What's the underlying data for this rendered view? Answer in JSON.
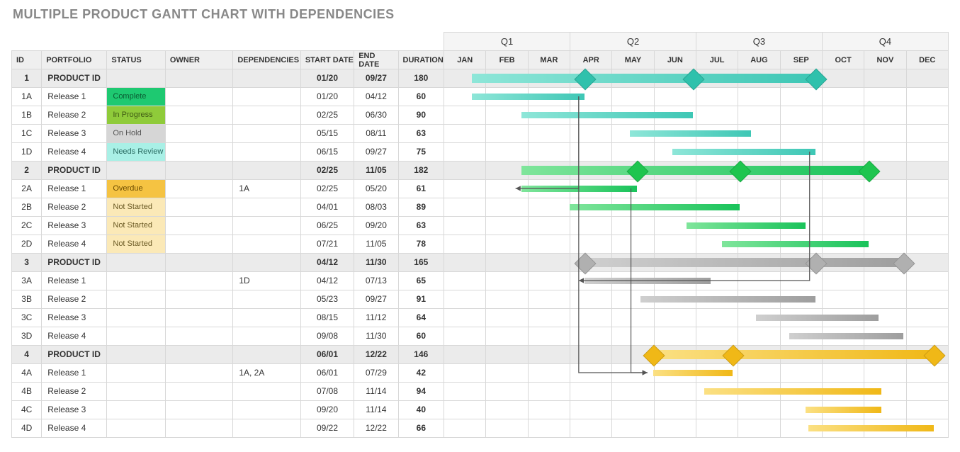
{
  "title": "MULTIPLE PRODUCT GANTT CHART WITH DEPENDENCIES",
  "columns": {
    "id": "ID",
    "portfolio": "PORTFOLIO",
    "status": "STATUS",
    "owner": "OWNER",
    "dependencies": "DEPENDENCIES",
    "start": "START DATE",
    "end": "END DATE",
    "duration": "DURATION"
  },
  "quarters": [
    "Q1",
    "Q2",
    "Q3",
    "Q4"
  ],
  "months": [
    "JAN",
    "FEB",
    "MAR",
    "APR",
    "MAY",
    "JUN",
    "JUL",
    "AUG",
    "SEP",
    "OCT",
    "NOV",
    "DEC"
  ],
  "status_labels": {
    "complete": "Complete",
    "progress": "In Progress",
    "hold": "On Hold",
    "review": "Needs Review",
    "overdue": "Overdue",
    "notstarted": "Not Started"
  },
  "chart_data": {
    "type": "gantt",
    "x_axis": "months",
    "months": [
      "JAN",
      "FEB",
      "MAR",
      "APR",
      "MAY",
      "JUN",
      "JUL",
      "AUG",
      "SEP",
      "OCT",
      "NOV",
      "DEC"
    ],
    "products": [
      {
        "id": "1",
        "name": "PRODUCT ID",
        "start": "01/20",
        "end": "09/27",
        "duration": 180,
        "color": "teal",
        "milestones": [
          "04/12",
          "06/30",
          "09/27"
        ],
        "tasks": [
          {
            "id": "1A",
            "name": "Release 1",
            "status": "Complete",
            "start": "01/20",
            "end": "04/12",
            "duration": 60
          },
          {
            "id": "1B",
            "name": "Release 2",
            "status": "In Progress",
            "start": "02/25",
            "end": "06/30",
            "duration": 90
          },
          {
            "id": "1C",
            "name": "Release 3",
            "status": "On Hold",
            "start": "05/15",
            "end": "08/11",
            "duration": 63
          },
          {
            "id": "1D",
            "name": "Release 4",
            "status": "Needs Review",
            "start": "06/15",
            "end": "09/27",
            "duration": 75
          }
        ]
      },
      {
        "id": "2",
        "name": "PRODUCT ID",
        "start": "02/25",
        "end": "11/05",
        "duration": 182,
        "color": "green",
        "milestones": [
          "05/20",
          "08/03",
          "11/05"
        ],
        "tasks": [
          {
            "id": "2A",
            "name": "Release 1",
            "status": "Overdue",
            "dep": "1A",
            "start": "02/25",
            "end": "05/20",
            "duration": 61
          },
          {
            "id": "2B",
            "name": "Release 2",
            "status": "Not Started",
            "start": "04/01",
            "end": "08/03",
            "duration": 89
          },
          {
            "id": "2C",
            "name": "Release 3",
            "status": "Not Started",
            "start": "06/25",
            "end": "09/20",
            "duration": 63
          },
          {
            "id": "2D",
            "name": "Release 4",
            "status": "Not Started",
            "start": "07/21",
            "end": "11/05",
            "duration": 78
          }
        ]
      },
      {
        "id": "3",
        "name": "PRODUCT ID",
        "start": "04/12",
        "end": "11/30",
        "duration": 165,
        "color": "gray",
        "milestones": [
          "04/12",
          "09/27",
          "11/30"
        ],
        "tasks": [
          {
            "id": "3A",
            "name": "Release 1",
            "dep": "1D",
            "start": "04/12",
            "end": "07/13",
            "duration": 65
          },
          {
            "id": "3B",
            "name": "Release 2",
            "start": "05/23",
            "end": "09/27",
            "duration": 91
          },
          {
            "id": "3C",
            "name": "Release 3",
            "start": "08/15",
            "end": "11/12",
            "duration": 64
          },
          {
            "id": "3D",
            "name": "Release 4",
            "start": "09/08",
            "end": "11/30",
            "duration": 60
          }
        ]
      },
      {
        "id": "4",
        "name": "PRODUCT ID",
        "start": "06/01",
        "end": "12/22",
        "duration": 146,
        "color": "amber",
        "milestones": [
          "06/01",
          "07/29",
          "12/22"
        ],
        "tasks": [
          {
            "id": "4A",
            "name": "Release 1",
            "dep": "1A, 2A",
            "start": "06/01",
            "end": "07/29",
            "duration": 42
          },
          {
            "id": "4B",
            "name": "Release 2",
            "start": "07/08",
            "end": "11/14",
            "duration": 94
          },
          {
            "id": "4C",
            "name": "Release 3",
            "start": "09/20",
            "end": "11/14",
            "duration": 40
          },
          {
            "id": "4D",
            "name": "Release 4",
            "start": "09/22",
            "end": "12/22",
            "duration": 66
          }
        ]
      }
    ],
    "dependency_arrows": [
      {
        "from": "1A",
        "to": "2A"
      },
      {
        "from": "1D",
        "to": "3A"
      },
      {
        "from": "2A",
        "to": "4A"
      },
      {
        "from": "1A",
        "to": "4A"
      }
    ]
  }
}
